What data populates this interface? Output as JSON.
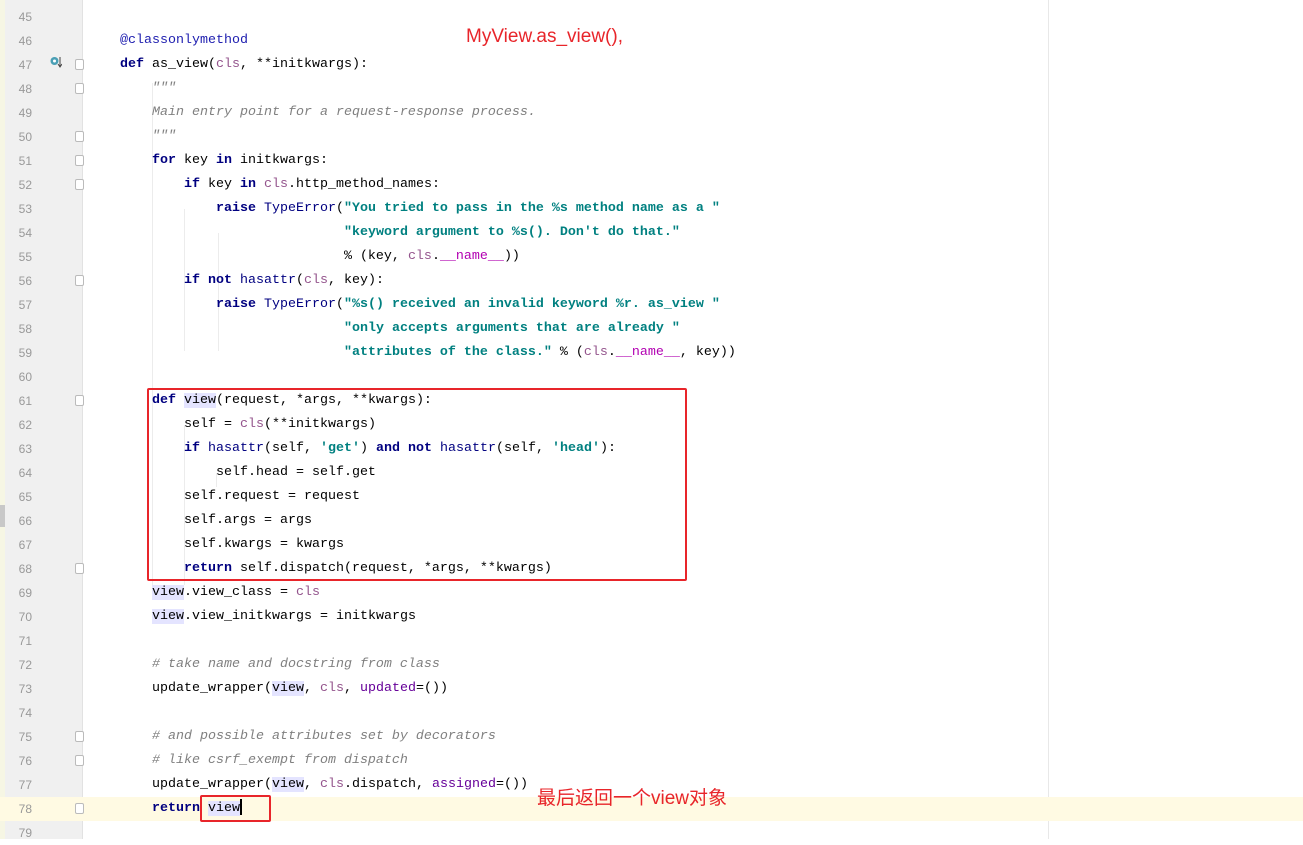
{
  "editor": {
    "current_line": 78,
    "lines": [
      {
        "n": "45",
        "t": []
      },
      {
        "n": "46",
        "t": [
          [
            "dec",
            "    @classonlymethod"
          ]
        ]
      },
      {
        "n": "47",
        "t": [
          [
            "kw",
            "    def "
          ],
          [
            "",
            "as_view("
          ],
          [
            "par",
            "cls"
          ],
          [
            "",
            ", **initkwargs):"
          ]
        ]
      },
      {
        "n": "48",
        "t": [
          [
            "cmt",
            "        \"\"\""
          ]
        ]
      },
      {
        "n": "49",
        "t": [
          [
            "cmt",
            "        Main entry point for a request-response process."
          ]
        ]
      },
      {
        "n": "50",
        "t": [
          [
            "cmt",
            "        \"\"\""
          ]
        ]
      },
      {
        "n": "51",
        "t": [
          [
            "kw",
            "        for "
          ],
          [
            "",
            "key "
          ],
          [
            "kw",
            "in "
          ],
          [
            "",
            "initkwargs:"
          ]
        ]
      },
      {
        "n": "52",
        "t": [
          [
            "kw",
            "            if "
          ],
          [
            "",
            "key "
          ],
          [
            "kw",
            "in "
          ],
          [
            "par",
            "cls"
          ],
          [
            "",
            ".http_method_names:"
          ]
        ]
      },
      {
        "n": "53",
        "t": [
          [
            "kw",
            "                raise "
          ],
          [
            "bi",
            "TypeError"
          ],
          [
            "",
            "("
          ],
          [
            "str",
            "\"You tried to pass in the %s method name as a \""
          ]
        ]
      },
      {
        "n": "54",
        "t": [
          [
            "",
            "                                "
          ],
          [
            "str",
            "\"keyword argument to %s(). Don't do that.\""
          ]
        ]
      },
      {
        "n": "55",
        "t": [
          [
            "",
            "                                % (key, "
          ],
          [
            "par",
            "cls"
          ],
          [
            "",
            "."
          ],
          [
            "dun",
            "__name__"
          ],
          [
            "",
            "))"
          ]
        ]
      },
      {
        "n": "56",
        "t": [
          [
            "kw",
            "            if not "
          ],
          [
            "bi",
            "hasattr"
          ],
          [
            "",
            "("
          ],
          [
            "par",
            "cls"
          ],
          [
            "",
            ", key):"
          ]
        ]
      },
      {
        "n": "57",
        "t": [
          [
            "kw",
            "                raise "
          ],
          [
            "bi",
            "TypeError"
          ],
          [
            "",
            "("
          ],
          [
            "str",
            "\"%s() received an invalid keyword %r. as_view \""
          ]
        ]
      },
      {
        "n": "58",
        "t": [
          [
            "",
            "                                "
          ],
          [
            "str",
            "\"only accepts arguments that are already \""
          ]
        ]
      },
      {
        "n": "59",
        "t": [
          [
            "",
            "                                "
          ],
          [
            "str",
            "\"attributes of the class.\""
          ],
          [
            "",
            " % ("
          ],
          [
            "par",
            "cls"
          ],
          [
            "",
            "."
          ],
          [
            "dun",
            "__name__"
          ],
          [
            "",
            ", key))"
          ]
        ]
      },
      {
        "n": "60",
        "t": []
      },
      {
        "n": "61",
        "t": [
          [
            "kw",
            "        def "
          ],
          [
            "hl",
            "view"
          ],
          [
            "",
            "(request, *args, **kwargs):"
          ]
        ]
      },
      {
        "n": "62",
        "t": [
          [
            "",
            "            self = "
          ],
          [
            "par",
            "cls"
          ],
          [
            "",
            "(**initkwargs)"
          ]
        ]
      },
      {
        "n": "63",
        "t": [
          [
            "kw",
            "            if "
          ],
          [
            "bi",
            "hasattr"
          ],
          [
            "",
            "(self, "
          ],
          [
            "str",
            "'get'"
          ],
          [
            ") ",
            ") "
          ],
          [
            "kw",
            "and not "
          ],
          [
            "bi",
            "hasattr"
          ],
          [
            "",
            "(self, "
          ],
          [
            "str",
            "'head'"
          ],
          [
            "",
            "):"
          ]
        ]
      },
      {
        "n": "64",
        "t": [
          [
            "",
            "                self.head = self.get"
          ]
        ]
      },
      {
        "n": "65",
        "t": [
          [
            "",
            "            self.request = request"
          ]
        ]
      },
      {
        "n": "66",
        "t": [
          [
            "",
            "            self.args = args"
          ]
        ]
      },
      {
        "n": "67",
        "t": [
          [
            "",
            "            self.kwargs = kwargs"
          ]
        ]
      },
      {
        "n": "68",
        "t": [
          [
            "kw",
            "            return "
          ],
          [
            "",
            "self.dispatch(request, *args, **kwargs)"
          ]
        ]
      },
      {
        "n": "69",
        "t": [
          [
            "",
            "        "
          ],
          [
            "hl",
            "view"
          ],
          [
            "",
            ".view_class = "
          ],
          [
            "par",
            "cls"
          ]
        ]
      },
      {
        "n": "70",
        "t": [
          [
            "",
            "        "
          ],
          [
            "hl",
            "view"
          ],
          [
            "",
            ".view_initkwargs = initkwargs"
          ]
        ]
      },
      {
        "n": "71",
        "t": []
      },
      {
        "n": "72",
        "t": [
          [
            "cmt",
            "        # take name and docstring from class"
          ]
        ]
      },
      {
        "n": "73",
        "t": [
          [
            "",
            "        update_wrapper("
          ],
          [
            "hl",
            "view"
          ],
          [
            "",
            ", "
          ],
          [
            "par",
            "cls"
          ],
          [
            "",
            ", "
          ],
          [
            "kwa",
            "updated"
          ],
          [
            "",
            "=())"
          ]
        ]
      },
      {
        "n": "74",
        "t": []
      },
      {
        "n": "75",
        "t": [
          [
            "cmt",
            "        # and possible attributes set by decorators"
          ]
        ]
      },
      {
        "n": "76",
        "t": [
          [
            "cmt",
            "        # like csrf_exempt from dispatch"
          ]
        ]
      },
      {
        "n": "77",
        "t": [
          [
            "",
            "        update_wrapper("
          ],
          [
            "hl",
            "view"
          ],
          [
            "",
            ", "
          ],
          [
            "par",
            "cls"
          ],
          [
            "",
            ".dispatch, "
          ],
          [
            "kwa",
            "assigned"
          ],
          [
            "",
            "=())"
          ]
        ]
      },
      {
        "n": "78",
        "t": [
          [
            "kw",
            "        return "
          ],
          [
            "hl",
            "view"
          ]
        ]
      },
      {
        "n": "79",
        "t": []
      }
    ],
    "fold_lines": [
      "47",
      "48",
      "50",
      "51",
      "52",
      "56",
      "61",
      "68",
      "75",
      "76",
      "78"
    ]
  },
  "annotations": {
    "top_note": "MyView.as_view(),",
    "bottom_note": "最后返回一个view对象",
    "color": "#e8252a"
  },
  "gutter_icons": {
    "line_47": "override-method-icon"
  }
}
